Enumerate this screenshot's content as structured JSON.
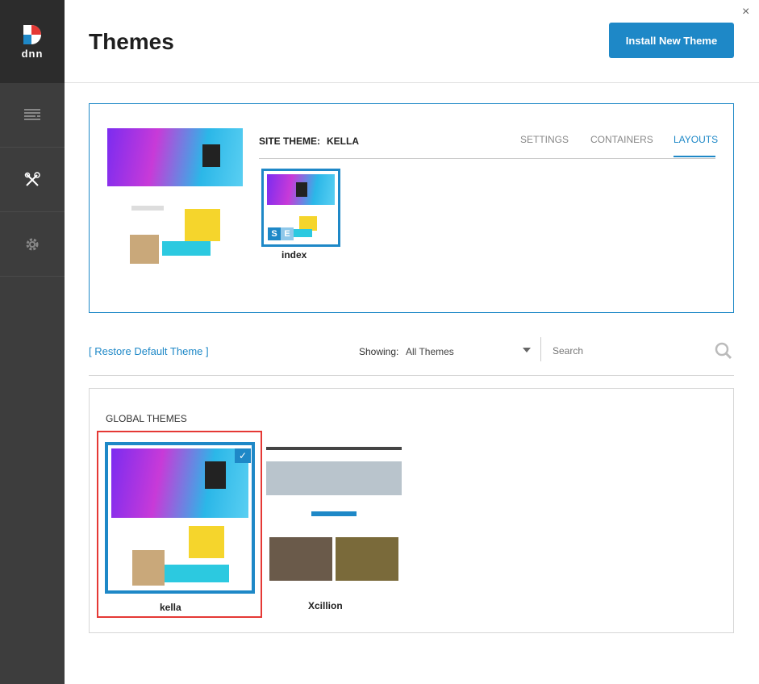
{
  "header": {
    "title": "Themes",
    "install_label": "Install New Theme",
    "close_glyph": "×"
  },
  "sidebar": {
    "logo_text": "dnn",
    "items": [
      "pages-icon",
      "tools-icon",
      "settings-icon"
    ]
  },
  "site_theme": {
    "label": "SITE THEME:",
    "name": "KELLA",
    "tabs": [
      "SETTINGS",
      "CONTAINERS",
      "LAYOUTS"
    ],
    "active_tab": "LAYOUTS",
    "layouts": [
      {
        "name": "index",
        "badges": [
          "S",
          "E"
        ]
      }
    ]
  },
  "toolbar": {
    "restore_label": "[ Restore Default Theme ]",
    "showing_label": "Showing:",
    "showing_value": "All Themes",
    "search_placeholder": "Search"
  },
  "themes": {
    "section_title": "GLOBAL THEMES",
    "items": [
      {
        "name": "kella",
        "selected": true
      },
      {
        "name": "Xcillion",
        "selected": false
      }
    ]
  },
  "colors": {
    "accent": "#1e88c7",
    "selection": "#e53935",
    "sidebar": "#3d3d3d"
  }
}
